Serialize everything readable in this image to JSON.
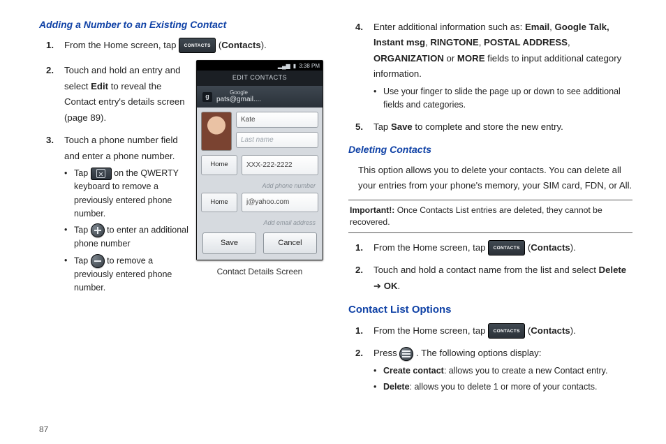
{
  "page_number": "87",
  "left": {
    "heading": "Adding a Number to an Existing Contact",
    "step1_a": "From the Home screen, tap ",
    "step1_b": " (",
    "step1_bold": "Contacts",
    "step1_c": ").",
    "step2_a": "Touch and hold an entry and select ",
    "step2_bold": "Edit",
    "step2_b": " to reveal the Contact entry's details screen (page 89).",
    "step3": "Touch a phone number field and enter a phone number.",
    "b1_a": "Tap ",
    "b1_b": " on the QWERTY keyboard to remove a previously entered phone number.",
    "b2_a": "Tap ",
    "b2_b": " to enter an additional phone number",
    "b3_a": "Tap ",
    "b3_b": " to remove a previously entered phone number.",
    "caption": "Contact Details Screen"
  },
  "phone": {
    "time": "3:38 PM",
    "title": "EDIT CONTACTS",
    "provider": "Google",
    "acct": "pats@gmail....",
    "first_name": "Kate",
    "last_name_ph": "Last name",
    "type1": "Home",
    "phone_val": "XXX-222-2222",
    "add_phone": "Add phone number",
    "type2": "Home",
    "email_val": "j@yahoo.com",
    "add_email": "Add email address",
    "save": "Save",
    "cancel": "Cancel"
  },
  "right": {
    "r4_a": "Enter additional information such as: ",
    "r4_email": "Email",
    "r4_s1": ", ",
    "r4_gtalk": "Google Talk, Instant msg",
    "r4_s2": ", ",
    "r4_ring": "RINGTONE",
    "r4_s3": ", ",
    "r4_postal": "POSTAL ADDRESS",
    "r4_s4": ", ",
    "r4_org": "ORGANIZATION",
    "r4_or": " or ",
    "r4_more": "MORE",
    "r4_tail": " fields to input additional category information.",
    "r4_sub": "Use your finger to slide the page up or down to see additional fields and categories.",
    "r5_a": "Tap ",
    "r5_save": "Save",
    "r5_b": " to complete and store the new entry.",
    "del_heading": "Deleting Contacts",
    "del_para": "This option allows you to delete your contacts. You can delete all your entries from your phone's memory, your SIM card, FDN, or All.",
    "important_label": "Important!:",
    "important": " Once Contacts List entries are deleted, they cannot be recovered.",
    "d1_a": "From the Home screen, tap ",
    "d1_b": " (",
    "d1_bold": "Contacts",
    "d1_c": ").",
    "d2_a": "Touch and hold a contact name from the list and select ",
    "d2_del": "Delete",
    "d2_arrow": " ➔ ",
    "d2_ok": "OK",
    "d2_dot": ".",
    "clo_heading": "Contact List Options",
    "c1_a": "From the Home screen, tap ",
    "c1_b": " (",
    "c1_bold": "Contacts",
    "c1_c": ").",
    "c2_a": "Press ",
    "c2_b": ". The following options display:",
    "c_b1a": "Create contact",
    "c_b1b": ": allows you to create a new Contact entry.",
    "c_b2a": "Delete",
    "c_b2b": ": allows you to delete 1 or more of your contacts."
  }
}
